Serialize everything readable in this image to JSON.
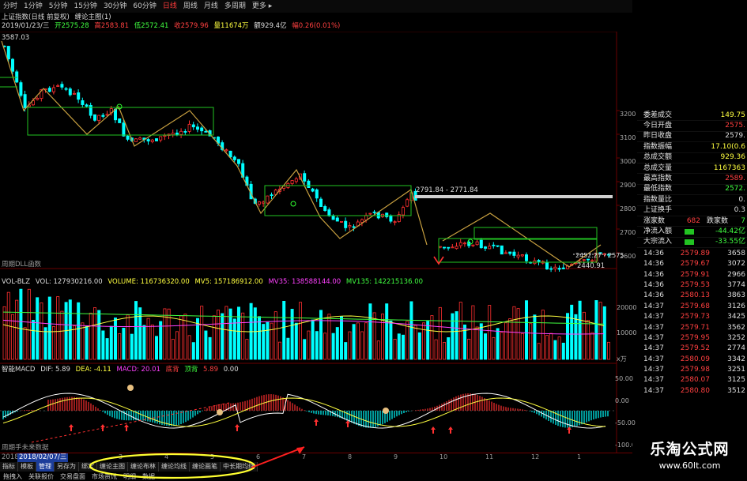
{
  "toolbar": {
    "periods": [
      "分时",
      "1分钟",
      "5分钟",
      "15分钟",
      "30分钟",
      "60分钟",
      "日线",
      "周线",
      "月线",
      "多周期",
      "更多 ▸"
    ],
    "active_index": 6
  },
  "chart_header": {
    "title": "上证指数(日线 前复权)",
    "formula": "缠论主图(1)",
    "date": "2019/01/23/三",
    "open": "开2575.28",
    "high": "高2583.81",
    "low": "低2572.41",
    "close": "收2579.96",
    "volume": "量11674万",
    "amount": "额929.4亿",
    "change": "幅0.26(0.01%)",
    "high_mark": "3587.03",
    "level_label": "2791.84 - 2771.84",
    "low_mark": "2440.91",
    "inner_label": "2452.27 - 2575"
  },
  "price_axis": [
    "3200",
    "3100",
    "3000",
    "2900",
    "2800",
    "2700",
    "2600"
  ],
  "price_panel_footer": "周期DLL函数",
  "volume_header": {
    "name": "VOL-BLZ",
    "vol": "VOL: 127930216.00",
    "volume": "VOLUME: 116736320.00",
    "mv5": "MV5: 157186912.00",
    "mv35": "MV35: 138588144.00",
    "mv135": "MV135: 142215136.00"
  },
  "volume_axis": [
    "20000",
    "10000",
    "x万"
  ],
  "macd_header": {
    "name": "智能MACD",
    "dif": "DIF: 5.89",
    "dea": "DEA: -4.11",
    "macd": "MACD: 20.01",
    "bottom": "底背",
    "top": "顶背",
    "v1": "5.89",
    "v2": "0.00"
  },
  "macd_axis": [
    "50.00",
    "0.00",
    "-50.00",
    "-100.00"
  ],
  "macd_footer": "周期手未来数据",
  "date_axis": {
    "year": "2018",
    "cursor_date": "2018/02/07/三",
    "ticks": [
      "3",
      "4",
      "5",
      "6",
      "7",
      "8",
      "9",
      "10",
      "11",
      "12",
      "1"
    ]
  },
  "bottom_tabs": [
    "指标",
    "模板",
    "管理",
    "另存为",
    "绑定",
    "缠论主图",
    "缠论布林",
    "缠论均线",
    "缠论画笔",
    "中长期均线"
  ],
  "bottom_tab_selected": 2,
  "bottom_row": [
    "拖拽入",
    "关联报价",
    "交易盘面",
    "市场资讯",
    "明细",
    "数据"
  ],
  "stats_panel": [
    {
      "label": "委差成交",
      "value": "149.75",
      "color": "#ffff40"
    },
    {
      "label": "今日开盘",
      "value": "2575.",
      "color": "#ff4040"
    },
    {
      "label": "昨日收盘",
      "value": "2579.",
      "color": "#dddddd"
    },
    {
      "label": "指数振幅",
      "value": "17.10(0.6",
      "color": "#ffff40"
    },
    {
      "label": "总成交额",
      "value": "929.36",
      "color": "#ffff40"
    },
    {
      "label": "总成交量",
      "value": "1167363",
      "color": "#ffff40"
    },
    {
      "label": "最高指数",
      "value": "2589.",
      "color": "#ff4040"
    },
    {
      "label": "最低指数",
      "value": "2572.",
      "color": "#40ff40"
    },
    {
      "label": "指数量比",
      "value": "0.",
      "color": "#dddddd"
    },
    {
      "label": "上证换手",
      "value": "0.3",
      "color": "#dddddd"
    },
    {
      "label": "涨家数",
      "value": "682",
      "color": "#ff4040",
      "extra": "跌家数",
      "extra_val": "7"
    },
    {
      "label": "净流入额",
      "value": "-44.42亿",
      "color": "#40ff40",
      "bar": true
    },
    {
      "label": "大宗流入",
      "value": "-33.55亿",
      "color": "#40ff40",
      "bar": true
    }
  ],
  "ticks": [
    {
      "t": "14:36",
      "p": "2579.89",
      "v": "3658"
    },
    {
      "t": "14:36",
      "p": "2579.67",
      "v": "3072"
    },
    {
      "t": "14:36",
      "p": "2579.91",
      "v": "2966"
    },
    {
      "t": "14:36",
      "p": "2579.53",
      "v": "3774"
    },
    {
      "t": "14:36",
      "p": "2580.13",
      "v": "3863"
    },
    {
      "t": "14:37",
      "p": "2579.68",
      "v": "3126"
    },
    {
      "t": "14:37",
      "p": "2579.73",
      "v": "3425"
    },
    {
      "t": "14:37",
      "p": "2579.71",
      "v": "3562"
    },
    {
      "t": "14:37",
      "p": "2579.95",
      "v": "3252"
    },
    {
      "t": "14:37",
      "p": "2579.52",
      "v": "2774"
    },
    {
      "t": "14:37",
      "p": "2580.09",
      "v": "3342"
    },
    {
      "t": "14:37",
      "p": "2579.98",
      "v": "3251"
    },
    {
      "t": "14:37",
      "p": "2580.07",
      "v": "3125"
    },
    {
      "t": "14:37",
      "p": "2580.80",
      "v": "3512"
    }
  ],
  "watermark": {
    "title": "乐淘公式网",
    "url": "www.60lt.com"
  },
  "colors": {
    "up": "#ff3030",
    "down": "#00ffff",
    "frame": "#8b0000",
    "hub": "#22c322",
    "pen": "#c8a040"
  }
}
